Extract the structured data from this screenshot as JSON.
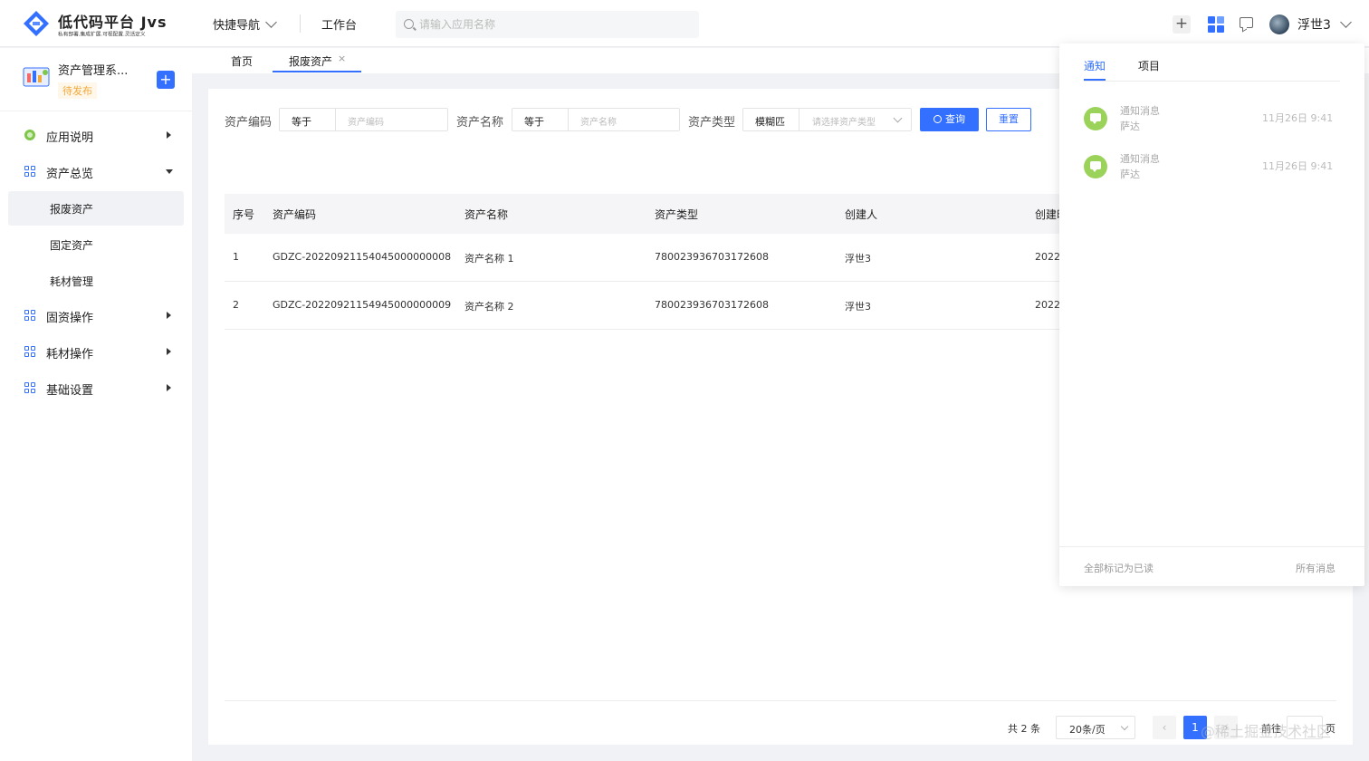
{
  "header": {
    "logo_title": "低代码平台 Jvs",
    "logo_subtitle": "私有部署.集成扩展.可视配置.灵活定义",
    "quick_nav": "快捷导航",
    "workbench": "工作台",
    "search_placeholder": "请输入应用名称",
    "plus": "+",
    "user_name": "浮世3"
  },
  "sidebar": {
    "app_name": "资产管理系...",
    "app_status": "待发布",
    "add": "+",
    "items": [
      {
        "label": "应用说明",
        "icon": "circle-icon",
        "expanded": false
      },
      {
        "label": "资产总览",
        "icon": "grid-icon",
        "expanded": true
      },
      {
        "label": "固资操作",
        "icon": "grid-icon",
        "expanded": false
      },
      {
        "label": "耗材操作",
        "icon": "grid-icon",
        "expanded": false
      },
      {
        "label": "基础设置",
        "icon": "grid-icon",
        "expanded": false
      }
    ],
    "sub_items": [
      {
        "label": "报废资产",
        "active": true
      },
      {
        "label": "固定资产",
        "active": false
      },
      {
        "label": "耗材管理",
        "active": false
      }
    ]
  },
  "tabs": [
    {
      "label": "首页",
      "active": false
    },
    {
      "label": "报废资产",
      "active": true,
      "close": "×"
    }
  ],
  "filters": {
    "code_label": "资产编码",
    "code_op": "等于",
    "code_placeholder": "资产编码",
    "name_label": "资产名称",
    "name_op": "等于",
    "name_placeholder": "资产名称",
    "type_label": "资产类型",
    "type_op": "模糊匹",
    "type_placeholder": "请选择资产类型",
    "query": "查询",
    "reset": "重置"
  },
  "table": {
    "columns": [
      "序号",
      "资产编码",
      "资产名称",
      "资产类型",
      "创建人",
      "创建时"
    ],
    "rows": [
      [
        "1",
        "GDZC-20220921154045000000008",
        "资产名称 1",
        "780023936703172608",
        "浮世3",
        "2022"
      ],
      [
        "2",
        "GDZC-20220921154945000000009",
        "资产名称 2",
        "780023936703172608",
        "浮世3",
        "2022"
      ]
    ]
  },
  "pagination": {
    "total": "共 2 条",
    "page_size": "20条/页",
    "prev": "‹",
    "current": "1",
    "next": "›",
    "goto": "前往",
    "page": "页"
  },
  "notification": {
    "tabs": [
      "通知",
      "项目"
    ],
    "items": [
      {
        "title": "通知消息",
        "sender": "萨达",
        "time": "11月26日 9:41"
      },
      {
        "title": "通知消息",
        "sender": "萨达",
        "time": "11月26日 9:41"
      }
    ],
    "mark_all_read": "全部标记为已读",
    "all_messages": "所有消息"
  },
  "watermark": "@稀土掘金技术社区",
  "colors": {
    "accent": "#3370ff",
    "status_pending": "#f2a93b",
    "notify_icon": "#9bd35a"
  }
}
